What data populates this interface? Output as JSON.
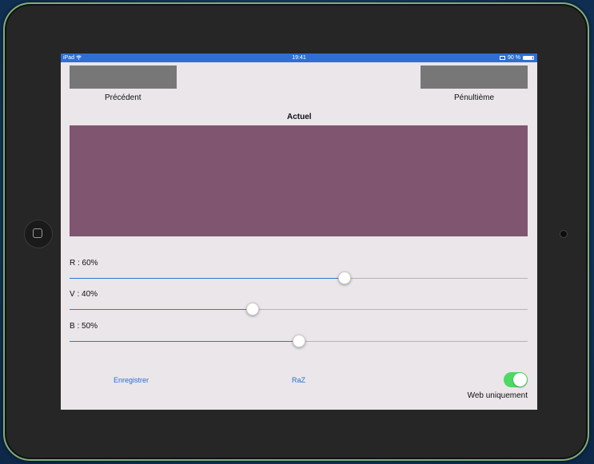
{
  "status_bar": {
    "device": "iPad",
    "wifi_icon": "wifi-icon",
    "time": "19:41",
    "battery": "90 %",
    "battery_level": 0.9
  },
  "previous_swatches": {
    "left": {
      "label": "Précédent",
      "color": "#777777"
    },
    "right": {
      "label": "Pénultième",
      "color": "#777777"
    }
  },
  "current": {
    "label": "Actuel",
    "color": "#805570"
  },
  "sliders": [
    {
      "label": "R : 60%",
      "value": 0.6
    },
    {
      "label": "V : 40%",
      "value": 0.4
    },
    {
      "label": "B : 50%",
      "value": 0.5
    }
  ],
  "actions": {
    "save": "Enregistrer",
    "reset": "RaZ"
  },
  "toggle": {
    "label": "Web uniquement",
    "on": true
  },
  "colors": {
    "accent": "#2a7bd9",
    "switch_on": "#4cd964",
    "status_bar": "#2f6fd3"
  }
}
